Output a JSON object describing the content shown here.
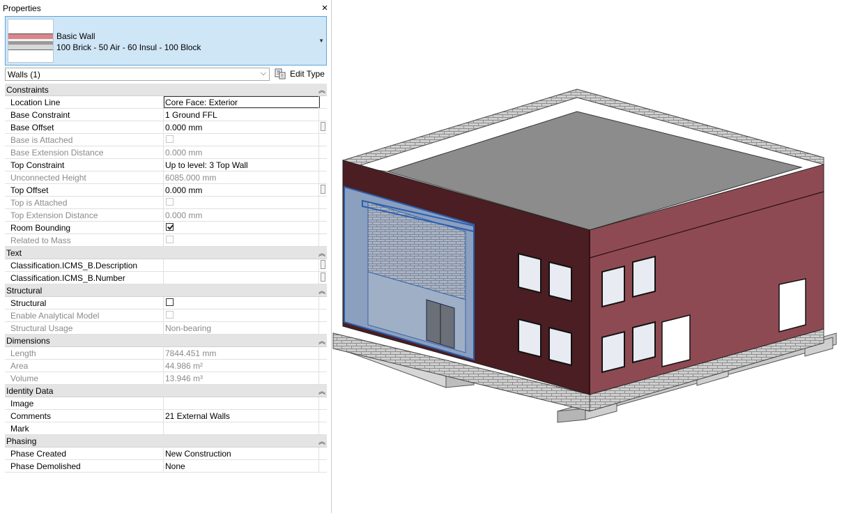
{
  "panel": {
    "title": "Properties",
    "close": "×",
    "type_selector": {
      "name": "Basic Wall",
      "description": "100 Brick - 50 Air - 60 Insul - 100 Block"
    },
    "filter": {
      "value": "Walls (1)",
      "edit_type": "Edit Type"
    }
  },
  "sections": {
    "constraints": {
      "label": "Constraints",
      "rows": {
        "location_line": {
          "name": "Location Line",
          "value": "Core Face: Exterior"
        },
        "base_constraint": {
          "name": "Base Constraint",
          "value": "1 Ground FFL"
        },
        "base_offset": {
          "name": "Base Offset",
          "value": "0.000 mm"
        },
        "base_attached": {
          "name": "Base is Attached"
        },
        "base_ext": {
          "name": "Base Extension Distance",
          "value": "0.000 mm"
        },
        "top_constraint": {
          "name": "Top Constraint",
          "value": "Up to level: 3 Top Wall"
        },
        "unconnected": {
          "name": "Unconnected Height",
          "value": "6085.000 mm"
        },
        "top_offset": {
          "name": "Top Offset",
          "value": "0.000 mm"
        },
        "top_attached": {
          "name": "Top is Attached"
        },
        "top_ext": {
          "name": "Top Extension Distance",
          "value": "0.000 mm"
        },
        "room_bounding": {
          "name": "Room Bounding"
        },
        "related_mass": {
          "name": "Related to Mass"
        }
      }
    },
    "text": {
      "label": "Text",
      "rows": {
        "desc": {
          "name": "Classification.ICMS_B.Description",
          "value": ""
        },
        "number": {
          "name": "Classification.ICMS_B.Number",
          "value": ""
        }
      }
    },
    "structural": {
      "label": "Structural",
      "rows": {
        "structural": {
          "name": "Structural"
        },
        "analytical": {
          "name": "Enable Analytical Model"
        },
        "usage": {
          "name": "Structural Usage",
          "value": "Non-bearing"
        }
      }
    },
    "dimensions": {
      "label": "Dimensions",
      "rows": {
        "length": {
          "name": "Length",
          "value": "7844.451 mm"
        },
        "area": {
          "name": "Area",
          "value": "44.986 m²"
        },
        "volume": {
          "name": "Volume",
          "value": "13.946 m³"
        }
      }
    },
    "identity": {
      "label": "Identity Data",
      "rows": {
        "image": {
          "name": "Image",
          "value": ""
        },
        "comments": {
          "name": "Comments",
          "value": "21 External Walls"
        },
        "mark": {
          "name": "Mark",
          "value": ""
        }
      }
    },
    "phasing": {
      "label": "Phasing",
      "rows": {
        "created": {
          "name": "Phase Created",
          "value": "New Construction"
        },
        "demolished": {
          "name": "Phase Demolished",
          "value": "None"
        }
      }
    }
  },
  "icons": {
    "close": "close-icon",
    "dropdown": "chevron-down-icon",
    "edit_type": "edit-type-icon",
    "collapse": "double-chevron-up-icon"
  },
  "colors": {
    "selection": "#cfe6f7",
    "selection_border": "#5aa6dc",
    "brick_red": "#8e4a52",
    "dark_wall": "#4a1e22",
    "roof": "#8c8c8c"
  }
}
